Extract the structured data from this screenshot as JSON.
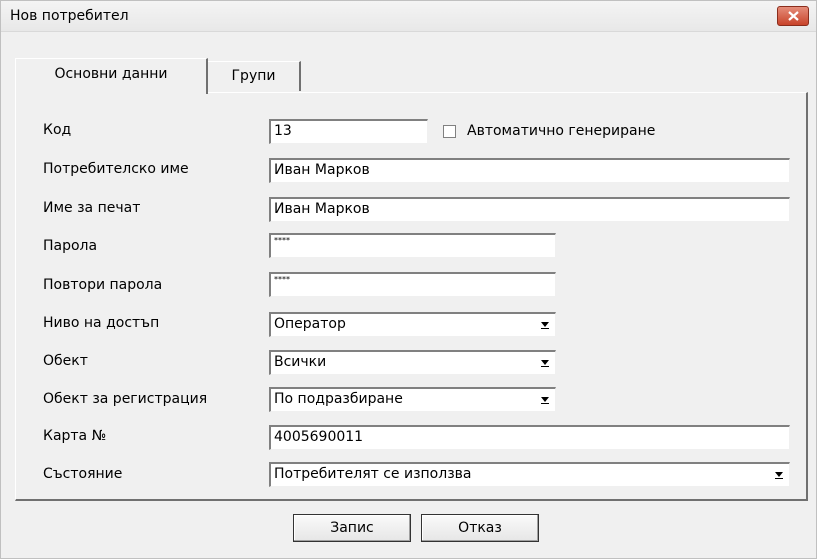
{
  "window": {
    "title": "Нов потребител"
  },
  "tabs": [
    {
      "label": "Основни данни"
    },
    {
      "label": "Групи"
    }
  ],
  "form": {
    "code": {
      "label": "Код",
      "value": "13"
    },
    "auto_generate": {
      "label": "Автоматично генериране",
      "checked": false
    },
    "username": {
      "label": "Потребителско име",
      "value": "Иван Марков"
    },
    "print_name": {
      "label": "Име за печат",
      "value": "Иван Марков"
    },
    "password": {
      "label": "Парола",
      "value": "****"
    },
    "repeat_password": {
      "label": "Повтори парола",
      "value": "****"
    },
    "access_level": {
      "label": "Ниво на достъп",
      "value": "Оператор"
    },
    "object": {
      "label": "Обект",
      "value": "Всички"
    },
    "registration_object": {
      "label": "Обект за регистрация",
      "value": "По подразбиране"
    },
    "card_no": {
      "label": "Карта №",
      "value": "4005690011"
    },
    "status": {
      "label": "Състояние",
      "value": "Потребителят се използва"
    }
  },
  "buttons": {
    "save": "Запис",
    "cancel": "Отказ"
  }
}
